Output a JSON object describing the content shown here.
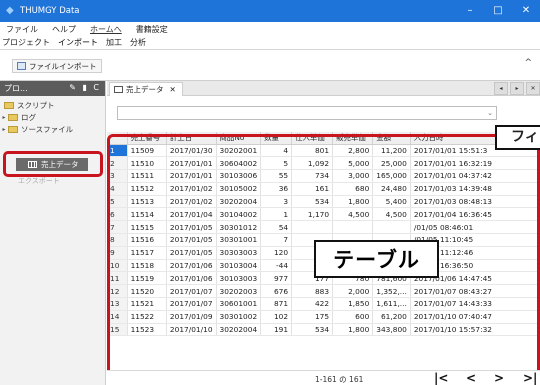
{
  "window": {
    "title": "THUMGY Data",
    "minimize": "–",
    "maximize": "□",
    "close": "✕"
  },
  "menu": [
    "ファイル",
    "ヘルプ",
    "ホームへ",
    "書籍設定"
  ],
  "ribbon_tabs": [
    "プロジェクト",
    "インポート",
    "加工",
    "分析"
  ],
  "ribbon": {
    "import_label": "ファイルインポート",
    "collapse": "^"
  },
  "left_pane": {
    "header": "プロ...",
    "tools": "✎ ▮ C",
    "items": [
      "スクリプト",
      "ログ",
      "ソースファイル"
    ],
    "selected": "売上データ",
    "faded": "エクスポート"
  },
  "tab": {
    "label": "売上データ",
    "close": "✕"
  },
  "tab_nav": [
    "◂",
    "▸",
    "✕"
  ],
  "filter": {
    "arrow": "⌄"
  },
  "table": {
    "columns": [
      "",
      "売上番号",
      "計上日",
      "商品No",
      "数量",
      "仕入単価",
      "販売単価",
      "金額",
      "入力日時"
    ],
    "rows": [
      [
        "1",
        "11509",
        "2017/01/30",
        "30202001",
        "4",
        "801",
        "2,800",
        "11,200",
        "2017/01/01 15:51:3"
      ],
      [
        "2",
        "11510",
        "2017/01/01",
        "30604002",
        "5",
        "1,092",
        "5,000",
        "25,000",
        "2017/01/01 16:32:19"
      ],
      [
        "3",
        "11511",
        "2017/01/01",
        "30103006",
        "55",
        "734",
        "3,000",
        "165,000",
        "2017/01/01 04:37:42"
      ],
      [
        "4",
        "11512",
        "2017/01/02",
        "30105002",
        "36",
        "161",
        "680",
        "24,480",
        "2017/01/03 14:39:48"
      ],
      [
        "5",
        "11513",
        "2017/01/02",
        "30202004",
        "3",
        "534",
        "1,800",
        "5,400",
        "2017/01/03 08:48:13"
      ],
      [
        "6",
        "11514",
        "2017/01/04",
        "30104002",
        "1",
        "1,170",
        "4,500",
        "4,500",
        "2017/01/04 16:36:45"
      ],
      [
        "7",
        "11515",
        "2017/01/05",
        "30301012",
        "54",
        "",
        "",
        "",
        "/01/05 08:46:01"
      ],
      [
        "8",
        "11516",
        "2017/01/05",
        "30301001",
        "7",
        "",
        "",
        "",
        "/01/05 11:10:45"
      ],
      [
        "9",
        "11517",
        "2017/01/05",
        "30303003",
        "120",
        "",
        "",
        "",
        "/01/05 11:12:46"
      ],
      [
        "10",
        "11518",
        "2017/01/06",
        "30103004",
        "-44",
        "",
        "",
        "",
        "/01/06 16:36:50"
      ],
      [
        "11",
        "11519",
        "2017/01/06",
        "30103003",
        "977",
        "177",
        "780",
        "781,600",
        "2017/01/06 14:47:45"
      ],
      [
        "12",
        "11520",
        "2017/01/07",
        "30202003",
        "676",
        "883",
        "2,000",
        "1,352,...",
        "2017/01/07 08:43:27"
      ],
      [
        "13",
        "11521",
        "2017/01/07",
        "30601001",
        "871",
        "422",
        "1,850",
        "1,611,...",
        "2017/01/07 14:43:33"
      ],
      [
        "14",
        "11522",
        "2017/01/09",
        "30301002",
        "102",
        "175",
        "600",
        "61,200",
        "2017/01/10 07:40:47"
      ],
      [
        "15",
        "11523",
        "2017/01/10",
        "30202004",
        "191",
        "534",
        "1,800",
        "343,800",
        "2017/01/10 15:57:32"
      ]
    ]
  },
  "pager": {
    "count": "1-161 の 161",
    "first": "|<",
    "prev": "<",
    "next": ">",
    "last": ">|"
  },
  "callouts": {
    "table": "テーブル",
    "filter_partial": "フィ"
  }
}
